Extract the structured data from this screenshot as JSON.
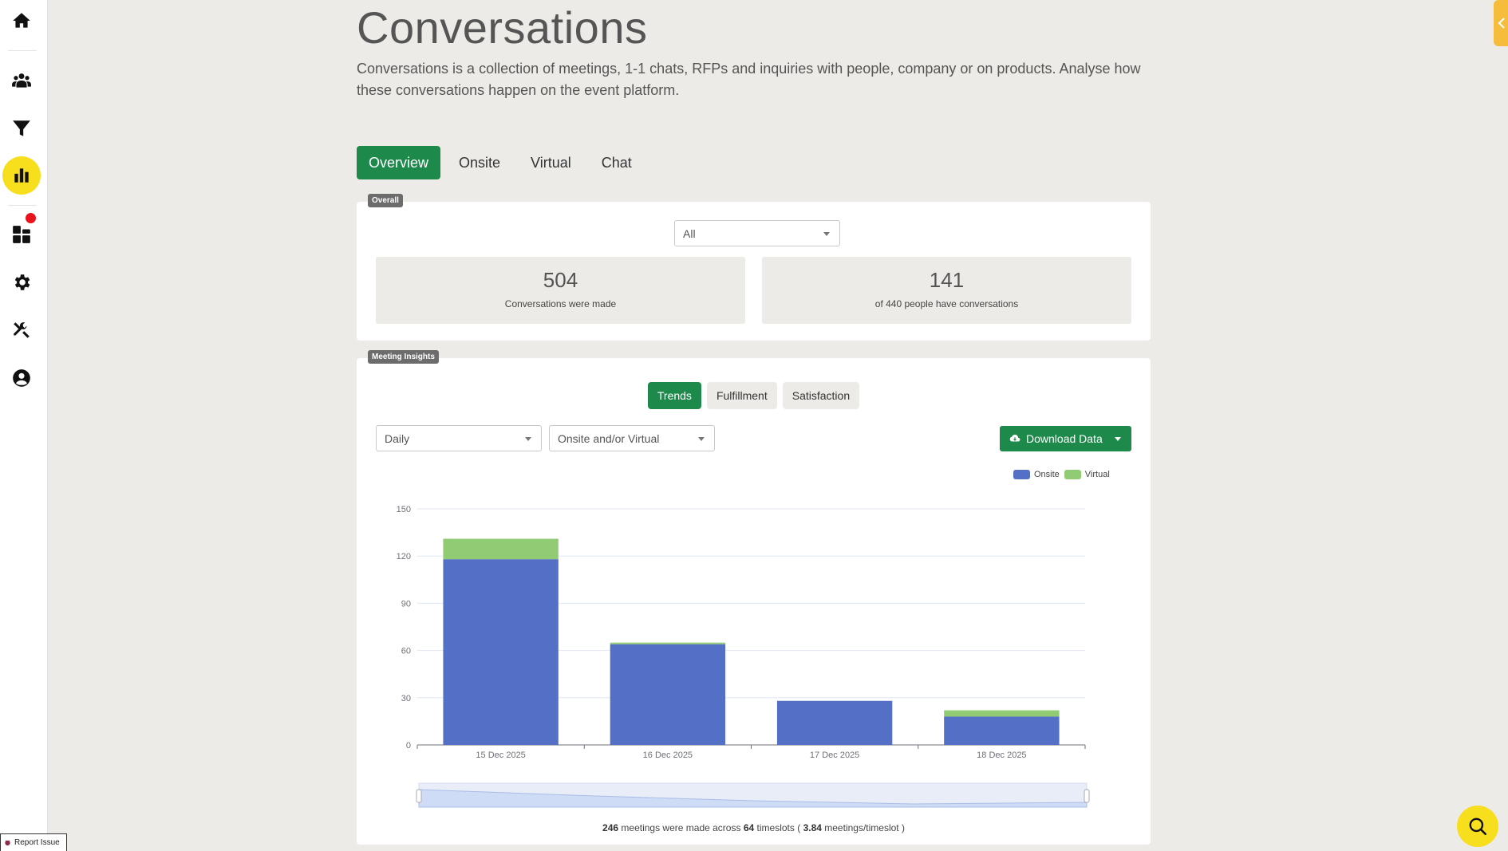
{
  "sidebar": {
    "items": [
      {
        "name": "home",
        "icon": "home-icon"
      },
      {
        "name": "people",
        "icon": "people-icon"
      },
      {
        "name": "funnel",
        "icon": "filter-icon"
      },
      {
        "name": "analytics",
        "icon": "bar-chart-icon",
        "active": true
      },
      {
        "name": "dashboard",
        "icon": "grid-icon",
        "notification": true
      },
      {
        "name": "settings",
        "icon": "gear-icon"
      },
      {
        "name": "tools",
        "icon": "tools-icon"
      },
      {
        "name": "account",
        "icon": "user-circle-icon"
      }
    ]
  },
  "header": {
    "title": "Conversations",
    "description": "Conversations is a collection of meetings, 1-1 chats, RFPs and inquiries with people, company or on products. Analyse how these conversations happen on the event platform."
  },
  "tabs": [
    {
      "label": "Overview",
      "active": true
    },
    {
      "label": "Onsite",
      "active": false
    },
    {
      "label": "Virtual",
      "active": false
    },
    {
      "label": "Chat",
      "active": false
    }
  ],
  "overall": {
    "badge": "Overall",
    "filter_value": "All",
    "stats": [
      {
        "value": "504",
        "label": "Conversations were made"
      },
      {
        "value": "141",
        "label": "of 440 people have conversations"
      }
    ]
  },
  "insights": {
    "badge": "Meeting Insights",
    "subtabs": [
      {
        "label": "Trends",
        "active": true
      },
      {
        "label": "Fulfillment",
        "active": false
      },
      {
        "label": "Satisfaction",
        "active": false
      }
    ],
    "period_select": "Daily",
    "mode_select": "Onsite and/or Virtual",
    "download_label": "Download Data",
    "summary": {
      "meetings": "246",
      "text1": "meetings were made across",
      "timeslots": "64",
      "text2": "timeslots (",
      "rate": "3.84",
      "text3": "meetings/timeslot )"
    }
  },
  "chart_data": {
    "type": "bar",
    "stacked": true,
    "categories": [
      "15 Dec 2025",
      "16 Dec 2025",
      "17 Dec 2025",
      "18 Dec 2025"
    ],
    "series": [
      {
        "name": "Onsite",
        "color": "#5470c6",
        "values": [
          118,
          64,
          28,
          18
        ]
      },
      {
        "name": "Virtual",
        "color": "#91cc75",
        "values": [
          13,
          1,
          0,
          4
        ]
      }
    ],
    "ylim": [
      0,
      150
    ],
    "yticks": [
      0,
      30,
      60,
      90,
      120,
      150
    ],
    "grid": true,
    "legend_position": "top-right",
    "data_zoom": true
  },
  "colors": {
    "accent": "#1d8a4c",
    "highlight": "#f7df1e"
  },
  "footer": {
    "report_label": "Report Issue"
  }
}
